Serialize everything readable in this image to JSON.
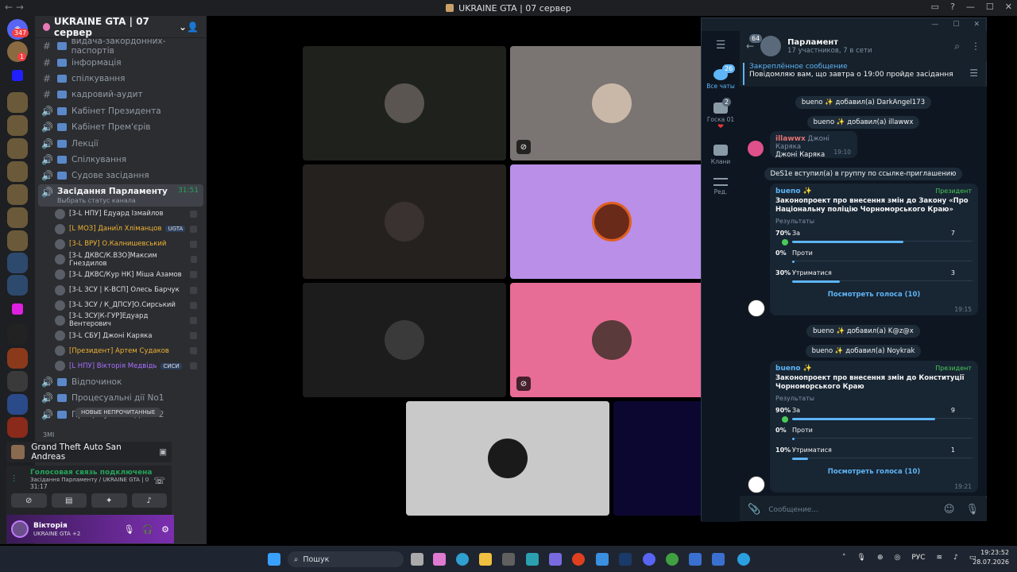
{
  "window": {
    "title": "UKRAINE GTA | 07 сервер"
  },
  "rail": {
    "badges": [
      "347",
      "1"
    ]
  },
  "server": {
    "name": "UKRAINE GTA | 07 сервер"
  },
  "channels": [
    {
      "type": "text",
      "label": "видача-закордонних-паспортів"
    },
    {
      "type": "text",
      "label": "інформація"
    },
    {
      "type": "text",
      "label": "спілкування"
    },
    {
      "type": "text",
      "label": "кадровий-аудит"
    },
    {
      "type": "voice",
      "label": "Кабінет Президента"
    },
    {
      "type": "voice",
      "label": "Кабінет Прем'єрів"
    },
    {
      "type": "voice",
      "label": "Лекції"
    },
    {
      "type": "voice",
      "label": "Спілкування"
    },
    {
      "type": "voice",
      "label": "Судове засідання"
    }
  ],
  "active_channel": {
    "label": "Засідання Парламенту",
    "sub": "Выбрать статус канала",
    "time": "31:51"
  },
  "members": [
    {
      "name": "[3-L НПУ] Едуард Ізмайлов",
      "tag": "",
      "color": "#dbdee1"
    },
    {
      "name": "[L МОЗ] Даниїл Хліманцов",
      "tag": "UGTA",
      "color": "#f0b232"
    },
    {
      "name": "[3-L ВРУ] О.Калнишевський",
      "tag": "",
      "color": "#f0b232"
    },
    {
      "name": "[3-L ДКВС/К.ВЗО]Максим Гнездилов",
      "tag": "",
      "color": "#dbdee1"
    },
    {
      "name": "[3-L ДКВС/Кур НК] Міша Азамов",
      "tag": "",
      "color": "#dbdee1"
    },
    {
      "name": "[3-L ЗСУ | К-ВСП] Олесь Барчук",
      "tag": "",
      "color": "#dbdee1"
    },
    {
      "name": "[3-L ЗСУ / К_ДПСУ]О.Сирський",
      "tag": "",
      "color": "#dbdee1"
    },
    {
      "name": "[3-L ЗСУ|К-ГУР]Едуард Вентерович",
      "tag": "",
      "color": "#dbdee1"
    },
    {
      "name": "[3-L СБУ] Джоні Каряка",
      "tag": "",
      "color": "#dbdee1"
    },
    {
      "name": "[Президент] Артем Судаков",
      "tag": "",
      "color": "#f0b232"
    },
    {
      "name": "[L НПУ] Вікторія Медвідь",
      "tag": "СИСИ",
      "color": "#a970ff"
    }
  ],
  "channels_after": [
    {
      "label": "Відпочинок"
    },
    {
      "label": "Процесуальні дії No1"
    },
    {
      "label": "Процесуальні дії No2"
    }
  ],
  "unread_label": "НОВЫЕ НЕПРОЧИТАННЫЕ",
  "category_label": "ЗМІ",
  "activity": {
    "game": "Grand Theft Auto San Andreas"
  },
  "voice": {
    "status": "Голосовая связь подключена",
    "channel": "Засідання Парламенту / UKRAINE GTA | 07 с...",
    "time": "31:17"
  },
  "user": {
    "name": "Віктoрія",
    "server": "UKRAINE GTA +2"
  },
  "telegram": {
    "folders": [
      {
        "label": "Все чаты",
        "badge": "26"
      },
      {
        "label": "Госка 01",
        "badge": "2"
      },
      {
        "label": "Клани",
        "badge": ""
      },
      {
        "label": "Ред.",
        "badge": ""
      }
    ],
    "back_badge": "64",
    "chat_name": "Парламент",
    "chat_sub": "17 участников, 7 в сети",
    "pinned_title": "Закреплённое сообщение",
    "pinned_text": "Повідомляю вам, що завтра о 19:00 пройде засідання ...",
    "svc1": "bueno ✨ добавил(а) DarkAngel173",
    "svc2": "bueno ✨ добавил(а) illawwx",
    "msg1": {
      "from": "illawwx",
      "reply": "Джоні Каряка",
      "text": "Джоні Каряка",
      "time": "19:10"
    },
    "svc3": "DeS1e вступил(а) в группу по ссылке-приглашению",
    "poll1": {
      "from": "bueno ✨",
      "role": "Президент",
      "question": "Законопроект про внесення змін до Закону «Про Національну поліцію Чорноморського Краю»",
      "results": "Результаты",
      "options": [
        {
          "pct": "70%",
          "label": "За",
          "count": "7",
          "value": 70,
          "checked": true
        },
        {
          "pct": "0%",
          "label": "Проти",
          "count": "",
          "value": 0,
          "checked": false
        },
        {
          "pct": "30%",
          "label": "Утриматися",
          "count": "3",
          "value": 30,
          "checked": false
        }
      ],
      "view": "Посмотреть голоса (10)",
      "time": "19:15"
    },
    "svc4": "bueno ✨ добавил(а) K@z@x",
    "svc5": "bueno ✨ добавил(а) Noykrak",
    "poll2": {
      "from": "bueno ✨",
      "role": "Президент",
      "question": "Законопроект про внесення змін до Конституції Чорноморського Краю",
      "results": "Результаты",
      "options": [
        {
          "pct": "90%",
          "label": "За",
          "count": "9",
          "value": 90,
          "checked": true
        },
        {
          "pct": "0%",
          "label": "Проти",
          "count": "",
          "value": 0,
          "checked": false
        },
        {
          "pct": "10%",
          "label": "Утриматися",
          "count": "1",
          "value": 10,
          "checked": false
        }
      ],
      "view": "Посмотреть голоса (10)",
      "time": "19:21"
    },
    "input_placeholder": "Сообщение..."
  },
  "taskbar": {
    "search": "Пошук",
    "lang": "РУС",
    "time": "19:23:52",
    "date": "28.07.2026"
  },
  "colors": {
    "accent": "#5eb5f7",
    "discord_bg": "#2b2d31",
    "tg_bg": "#0e1621"
  }
}
